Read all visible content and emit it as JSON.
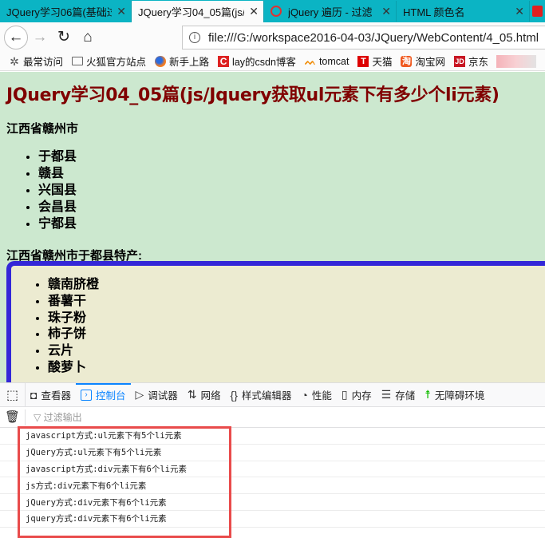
{
  "browser": {
    "tabs": [
      {
        "label": "JQuery学习06篇(基础过",
        "active": false,
        "icon": "none"
      },
      {
        "label": "JQuery学习04_05篇(js/J",
        "active": true,
        "icon": "none"
      },
      {
        "label": "jQuery 遍历 - 过滤",
        "active": false,
        "icon": "jquery-logo-icon"
      },
      {
        "label": "HTML 颜色名",
        "active": false,
        "icon": "none"
      }
    ],
    "tab_close_glyph": "✕",
    "url": "file:///G:/workspace2016-04-03/JQuery/WebContent/4_05.html",
    "nav": {
      "back": "←",
      "forward": "→",
      "reload": "↻",
      "home": "⌂",
      "info": "i"
    },
    "bookmarks": [
      {
        "label": "最常访问",
        "icon": "gear-icon",
        "glyph": "✲"
      },
      {
        "label": "火狐官方站点",
        "icon": "folder-icon",
        "glyph": ""
      },
      {
        "label": "新手上路",
        "icon": "firefox-icon",
        "glyph": ""
      },
      {
        "label": "lay的csdn博客",
        "icon": "csdn-icon",
        "glyph": "C"
      },
      {
        "label": "tomcat",
        "icon": "tomcat-icon",
        "glyph": "ᨓ"
      },
      {
        "label": "天猫",
        "icon": "tmall-icon",
        "glyph": "T"
      },
      {
        "label": "淘宝网",
        "icon": "taobao-icon",
        "glyph": "淘"
      },
      {
        "label": "京东",
        "icon": "jd-icon",
        "glyph": "JD"
      }
    ]
  },
  "page": {
    "title": "JQuery学习04_05篇(js/Jquery获取ul元素下有多少个li元素)",
    "city_heading": "江西省赣州市",
    "counties": [
      "于都县",
      "赣县",
      "兴国县",
      "会昌县",
      "宁都县"
    ],
    "specialty_heading": "江西省赣州市于都县特产:",
    "products": [
      "赣南脐橙",
      "番薯干",
      "珠子粉",
      "柿子饼",
      "云片",
      "酸萝卜"
    ]
  },
  "devtools": {
    "tabs": [
      {
        "label": "查看器",
        "glyph": "◘",
        "active": false
      },
      {
        "label": "控制台",
        "glyph": "›",
        "active": true
      },
      {
        "label": "调试器",
        "glyph": "▷",
        "active": false
      },
      {
        "label": "网络",
        "glyph": "⇅",
        "active": false
      },
      {
        "label": "样式编辑器",
        "glyph": "{}",
        "active": false
      },
      {
        "label": "性能",
        "glyph": "◔",
        "active": false
      },
      {
        "label": "内存",
        "glyph": "▯",
        "active": false
      },
      {
        "label": "存储",
        "glyph": "☰",
        "active": false
      },
      {
        "label": "无障碍环境",
        "glyph": "☨",
        "active": false
      }
    ],
    "picker_glyph": "⬚",
    "trash_glyph": "🗑",
    "filter_placeholder": "过滤输出",
    "filter_glyph": "▽",
    "console_logs": [
      "javascript方式:ul元素下有5个li元素",
      "jQuery方式:ul元素下有5个li元素",
      "javascript方式:div元素下有6个li元素",
      "js方式:div元素下有6个li元素",
      "jQuery方式:div元素下有6个li元素",
      "jquery方式:div元素下有6个li元素"
    ],
    "highlight_color": "#e94b4b"
  }
}
